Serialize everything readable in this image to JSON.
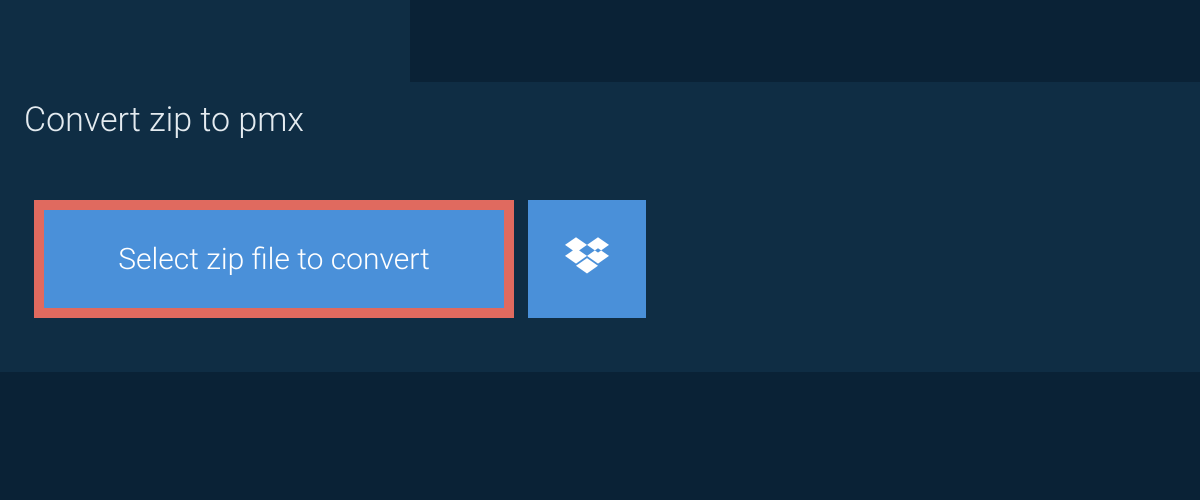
{
  "header": {
    "tab_label": "Convert zip to pmx"
  },
  "actions": {
    "select_file_label": "Select zip file to convert",
    "dropbox_icon_name": "dropbox-icon"
  },
  "colors": {
    "bg_dark": "#0a2236",
    "bg_panel": "#0f2d44",
    "button_blue": "#4a90d9",
    "highlight_border": "#e06a5f",
    "text_light": "#e4ebf0"
  }
}
